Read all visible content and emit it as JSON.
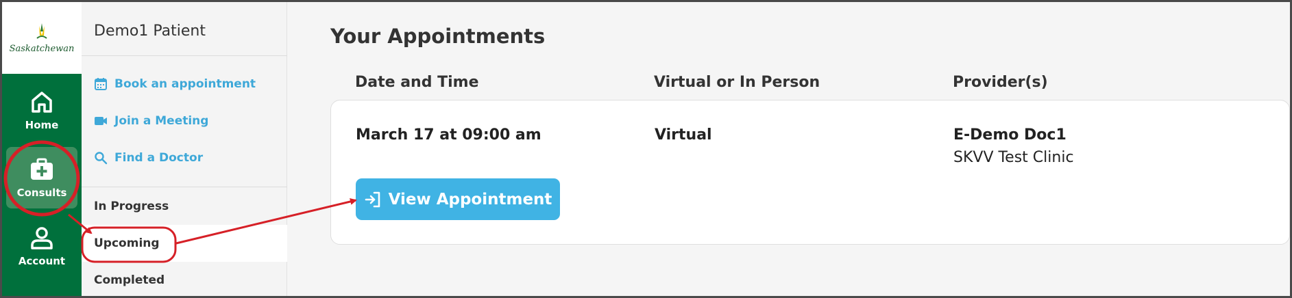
{
  "logo": {
    "text": "Saskatchewan"
  },
  "rail": {
    "items": [
      {
        "label": "Home",
        "icon": "home-icon"
      },
      {
        "label": "Consults",
        "icon": "medical-kit-icon"
      },
      {
        "label": "Account",
        "icon": "user-icon"
      }
    ]
  },
  "subnav": {
    "patient_name": "Demo1 Patient",
    "actions": [
      {
        "label": "Book an appointment",
        "icon": "calendar-icon"
      },
      {
        "label": "Join a Meeting",
        "icon": "video-camera-icon"
      },
      {
        "label": "Find a Doctor",
        "icon": "search-icon"
      }
    ],
    "statuses": [
      {
        "label": "In Progress"
      },
      {
        "label": "Upcoming"
      },
      {
        "label": "Completed"
      }
    ]
  },
  "main": {
    "title": "Your Appointments",
    "columns": [
      "Date and Time",
      "Virtual or In Person",
      "Provider(s)"
    ],
    "appointments": [
      {
        "date_time": "March 17 at 09:00 am",
        "mode": "Virtual",
        "provider": "E-Demo Doc1",
        "clinic": "SKVV Test Clinic",
        "button_label": "View Appointment",
        "button_icon": "sign-in-icon"
      }
    ]
  },
  "colors": {
    "rail_bg": "#00703c",
    "rail_active": "#3f8d5f",
    "link": "#3ea8d8",
    "button": "#40b3e4",
    "annotation": "#d62027"
  }
}
